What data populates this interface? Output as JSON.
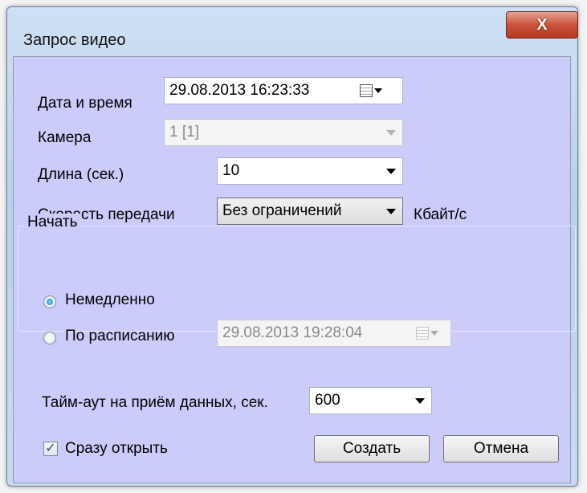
{
  "window": {
    "title": "Запрос видео",
    "close_glyph": "X"
  },
  "form": {
    "datetime": {
      "label": "Дата и время",
      "value": "29.08.2013 16:23:33"
    },
    "camera": {
      "label": "Камера",
      "value": "1 [1]"
    },
    "length": {
      "label": "Длина (сек.)",
      "value": "10"
    },
    "speed": {
      "label": "Скорость передачи",
      "value": "Без ограничений",
      "unit": "Кбайт/с"
    }
  },
  "start_group": {
    "label": "Начать",
    "immediately": {
      "label": "Немедленно",
      "selected": true
    },
    "scheduled": {
      "label": "По расписанию",
      "selected": false,
      "value": "29.08.2013 19:28:04"
    }
  },
  "timeout": {
    "label": "Тайм-аут на приём данных, сек.",
    "value": "600"
  },
  "open_now": {
    "label": "Сразу открыть",
    "checked": true,
    "check_glyph": "✓"
  },
  "buttons": {
    "create": "Создать",
    "cancel": "Отмена"
  },
  "icons": [
    "close-icon",
    "calendar-icon",
    "dropdown-arrow-icon",
    "radio-icon",
    "checkbox-icon"
  ]
}
